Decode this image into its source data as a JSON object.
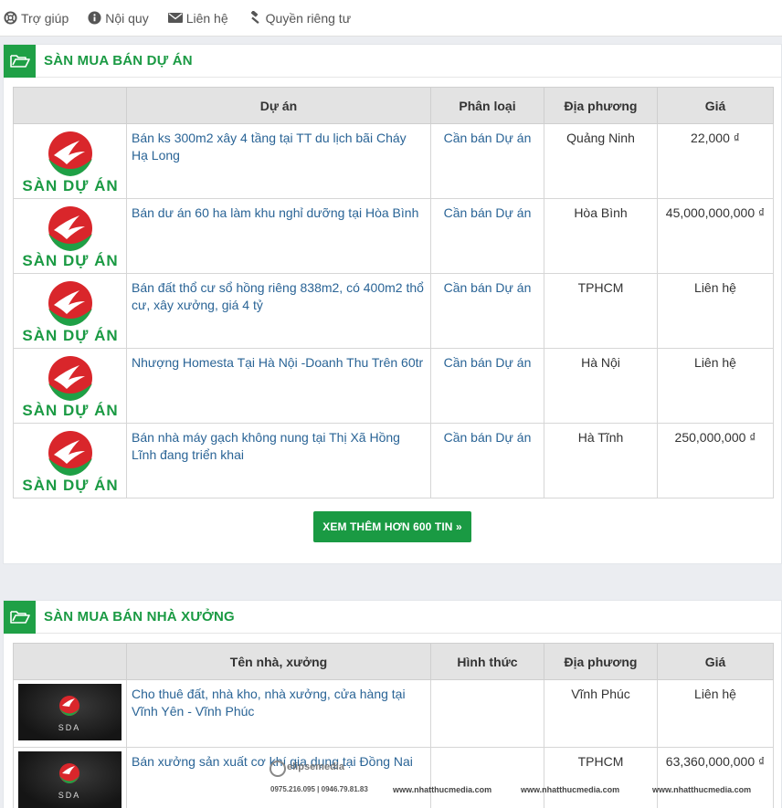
{
  "topnav": [
    {
      "label": "Trợ giúp",
      "icon": "lifebuoy-icon"
    },
    {
      "label": "Nội quy",
      "icon": "info-icon"
    },
    {
      "label": "Liên hệ",
      "icon": "envelope-icon"
    },
    {
      "label": "Quyền riêng tư",
      "icon": "gavel-icon"
    }
  ],
  "section_projects": {
    "title": "SÀN MUA BÁN DỰ ÁN",
    "headers": [
      "",
      "Dự án",
      "Phân loại",
      "Địa phương",
      "Giá"
    ],
    "logo_text": "SÀN DỰ ÁN",
    "rows": [
      {
        "title": "Bán ks 300m2 xây 4 tầng tại TT du lịch bãi Cháy Hạ Long",
        "type": "Cần bán Dự án",
        "location": "Quảng Ninh",
        "price": "22,000 ₫"
      },
      {
        "title": "Bán dư án 60 ha làm khu nghỉ dưỡng tại Hòa Bình",
        "type": "Cần bán Dự án",
        "location": "Hòa Bình",
        "price": "45,000,000,000 ₫"
      },
      {
        "title": "Bán đất thổ cư sổ hồng riêng 838m2, có 400m2 thổ cư, xây xưởng, giá 4 tỷ",
        "type": "Cần bán Dự án",
        "location": "TPHCM",
        "price": "Liên hệ"
      },
      {
        "title": "Nhượng Homesta Tại Hà Nội -Doanh Thu Trên 60tr",
        "type": "Cần bán Dự án",
        "location": "Hà Nội",
        "price": "Liên hệ"
      },
      {
        "title": "Bán nhà máy gạch không nung tại Thị Xã Hồng Lĩnh đang triển khai",
        "type": "Cần bán Dự án",
        "location": "Hà Tĩnh",
        "price": "250,000,000 ₫"
      }
    ],
    "more_button": "XEM THÊM HƠN 600 TIN »"
  },
  "section_factories": {
    "title": "SÀN MUA BÁN NHÀ XƯỞNG",
    "headers": [
      "",
      "Tên nhà, xưởng",
      "Hình thức",
      "Địa phương",
      "Giá"
    ],
    "thumb_text": "SDA",
    "rows": [
      {
        "title": "Cho thuê đất, nhà kho, nhà xưởng, cửa hàng tại Vĩnh Yên - Vĩnh Phúc",
        "type": "",
        "location": "Vĩnh Phúc",
        "price": "Liên hệ"
      },
      {
        "title": "Bán xưởng sản xuất cơ khí gia dụng tại Đồng Nai",
        "type": "",
        "location": "TPHCM",
        "price": "63,360,000,000 ₫"
      }
    ]
  },
  "watermark": {
    "brand": "elipsemedia",
    "site": "www.nhatthucmedia.com",
    "phones": "0975.216.095 | 0946.79.81.83"
  },
  "colors": {
    "brand_green": "#1a9a43",
    "link_blue": "#2a6496",
    "logo_red": "#d9262b"
  }
}
